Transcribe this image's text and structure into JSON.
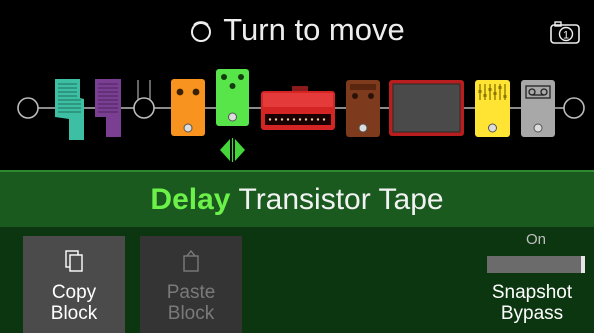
{
  "header": {
    "title": "Turn to move",
    "knob_icon": "rotate-knob-icon",
    "snapshot_icon": "camera-icon",
    "snapshot_number": "1"
  },
  "signal_chain": {
    "blocks": [
      {
        "name": "input-endpoint",
        "icon": "circle-node"
      },
      {
        "name": "teal-expression-pedal",
        "color": "#3dbfa3"
      },
      {
        "name": "purple-expression-pedal",
        "color": "#7a3f93"
      },
      {
        "name": "empty-split-block",
        "icon": "split-node"
      },
      {
        "name": "orange-stompbox",
        "color": "#f7931e"
      },
      {
        "name": "green-delay-stompbox",
        "color": "#57e54a",
        "selected": true
      },
      {
        "name": "red-amp-head",
        "color": "#d42424"
      },
      {
        "name": "brown-stompbox",
        "color": "#7d3a1c"
      },
      {
        "name": "red-speaker-cabinet",
        "color": "#b81e1e"
      },
      {
        "name": "yellow-eq-stompbox",
        "color": "#ffe433"
      },
      {
        "name": "gray-looper-stompbox",
        "color": "#a8a8a8"
      },
      {
        "name": "output-endpoint",
        "icon": "circle-node"
      }
    ],
    "move_arrows_color": "#44d63a"
  },
  "model": {
    "category": "Delay",
    "name": "Transistor Tape"
  },
  "buttons": {
    "copy": {
      "line1": "Copy",
      "line2": "Block"
    },
    "paste": {
      "line1": "Paste",
      "line2": "Block"
    }
  },
  "snapshot_bypass": {
    "state": "On",
    "line1": "Snapshot",
    "line2": "Bypass"
  }
}
